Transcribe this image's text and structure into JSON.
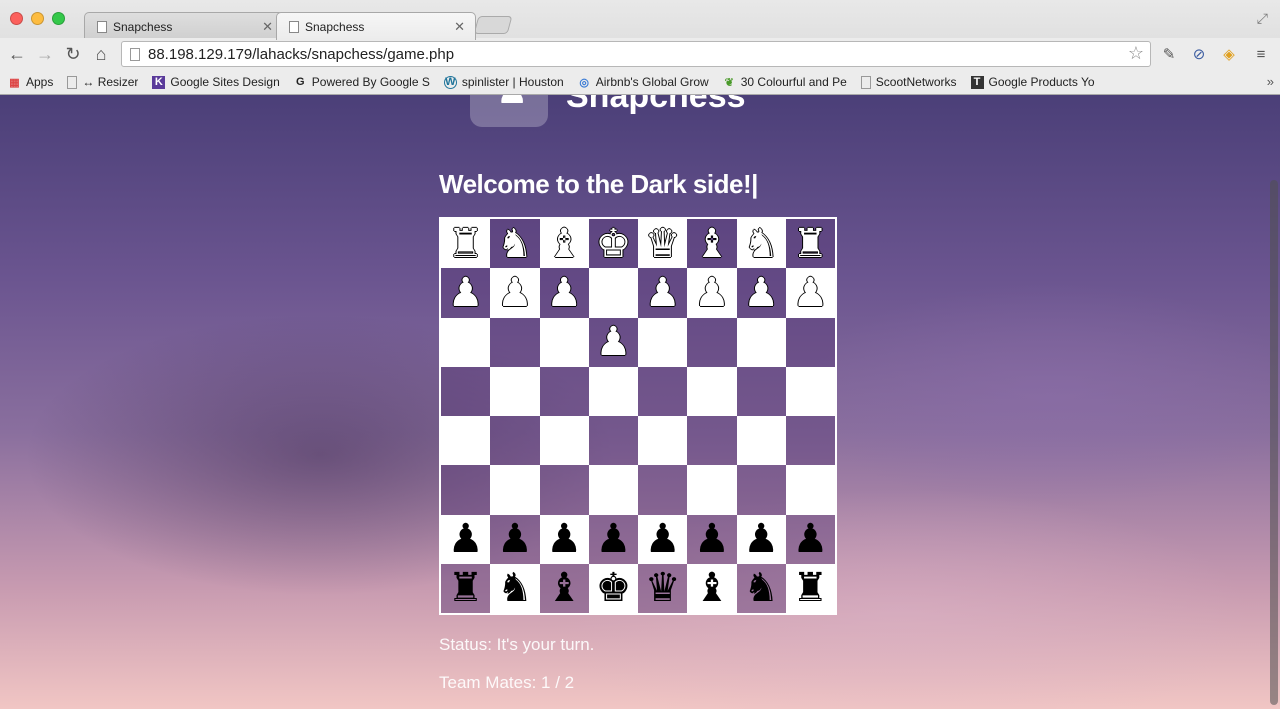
{
  "browser": {
    "tabs": [
      {
        "title": "Snapchess",
        "active": false
      },
      {
        "title": "Snapchess",
        "active": true
      }
    ],
    "url": "88.198.129.179/lahacks/snapchess/game.php",
    "bookmarks": [
      {
        "label": "Apps",
        "icon": "apps-grid-icon"
      },
      {
        "label": "↔ Resizer",
        "icon": "page-icon"
      },
      {
        "label": "Google Sites Design",
        "icon": "k-icon"
      },
      {
        "label": "Powered By Google S",
        "icon": "g-icon"
      },
      {
        "label": "spinlister | Houston",
        "icon": "wordpress-icon"
      },
      {
        "label": "Airbnb's Global Grow",
        "icon": "airbnb-icon"
      },
      {
        "label": "30 Colourful and Pe",
        "icon": "leaf-icon"
      },
      {
        "label": "ScootNetworks",
        "icon": "page-icon"
      },
      {
        "label": "Google Products Yo",
        "icon": "t-icon"
      }
    ]
  },
  "page": {
    "logo_text": "Snapchess",
    "heading": "Welcome to the Dark side!|",
    "status": "Status: It's your turn.",
    "team_mates": "Team Mates: 1 / 2"
  },
  "board": {
    "top_row_color": "white",
    "rows": [
      [
        {
          "p": "♜",
          "c": "w"
        },
        {
          "p": "♞",
          "c": "w"
        },
        {
          "p": "♝",
          "c": "w"
        },
        {
          "p": "♚",
          "c": "w"
        },
        {
          "p": "♛",
          "c": "w"
        },
        {
          "p": "♝",
          "c": "w"
        },
        {
          "p": "♞",
          "c": "w"
        },
        {
          "p": "♜",
          "c": "w"
        }
      ],
      [
        {
          "p": "♟",
          "c": "w"
        },
        {
          "p": "♟",
          "c": "w"
        },
        {
          "p": "♟",
          "c": "w"
        },
        {
          "p": "",
          "c": ""
        },
        {
          "p": "♟",
          "c": "w"
        },
        {
          "p": "♟",
          "c": "w"
        },
        {
          "p": "♟",
          "c": "w"
        },
        {
          "p": "♟",
          "c": "w"
        }
      ],
      [
        {
          "p": "",
          "c": ""
        },
        {
          "p": "",
          "c": ""
        },
        {
          "p": "",
          "c": ""
        },
        {
          "p": "♟",
          "c": "w"
        },
        {
          "p": "",
          "c": ""
        },
        {
          "p": "",
          "c": ""
        },
        {
          "p": "",
          "c": ""
        },
        {
          "p": "",
          "c": ""
        }
      ],
      [
        {
          "p": "",
          "c": ""
        },
        {
          "p": "",
          "c": ""
        },
        {
          "p": "",
          "c": ""
        },
        {
          "p": "",
          "c": ""
        },
        {
          "p": "",
          "c": ""
        },
        {
          "p": "",
          "c": ""
        },
        {
          "p": "",
          "c": ""
        },
        {
          "p": "",
          "c": ""
        }
      ],
      [
        {
          "p": "",
          "c": ""
        },
        {
          "p": "",
          "c": ""
        },
        {
          "p": "",
          "c": ""
        },
        {
          "p": "",
          "c": ""
        },
        {
          "p": "",
          "c": ""
        },
        {
          "p": "",
          "c": ""
        },
        {
          "p": "",
          "c": ""
        },
        {
          "p": "",
          "c": ""
        }
      ],
      [
        {
          "p": "",
          "c": ""
        },
        {
          "p": "",
          "c": ""
        },
        {
          "p": "",
          "c": ""
        },
        {
          "p": "",
          "c": ""
        },
        {
          "p": "",
          "c": ""
        },
        {
          "p": "",
          "c": ""
        },
        {
          "p": "",
          "c": ""
        },
        {
          "p": "",
          "c": ""
        }
      ],
      [
        {
          "p": "♟",
          "c": "b"
        },
        {
          "p": "♟",
          "c": "b"
        },
        {
          "p": "♟",
          "c": "b"
        },
        {
          "p": "♟",
          "c": "b"
        },
        {
          "p": "♟",
          "c": "b"
        },
        {
          "p": "♟",
          "c": "b"
        },
        {
          "p": "♟",
          "c": "b"
        },
        {
          "p": "♟",
          "c": "b"
        }
      ],
      [
        {
          "p": "♜",
          "c": "b"
        },
        {
          "p": "♞",
          "c": "b"
        },
        {
          "p": "♝",
          "c": "b"
        },
        {
          "p": "♚",
          "c": "b"
        },
        {
          "p": "♛",
          "c": "b"
        },
        {
          "p": "♝",
          "c": "b"
        },
        {
          "p": "♞",
          "c": "b"
        },
        {
          "p": "♜",
          "c": "b"
        }
      ]
    ],
    "light_color": "#ffffff",
    "dark_color": "#7a5a96"
  }
}
